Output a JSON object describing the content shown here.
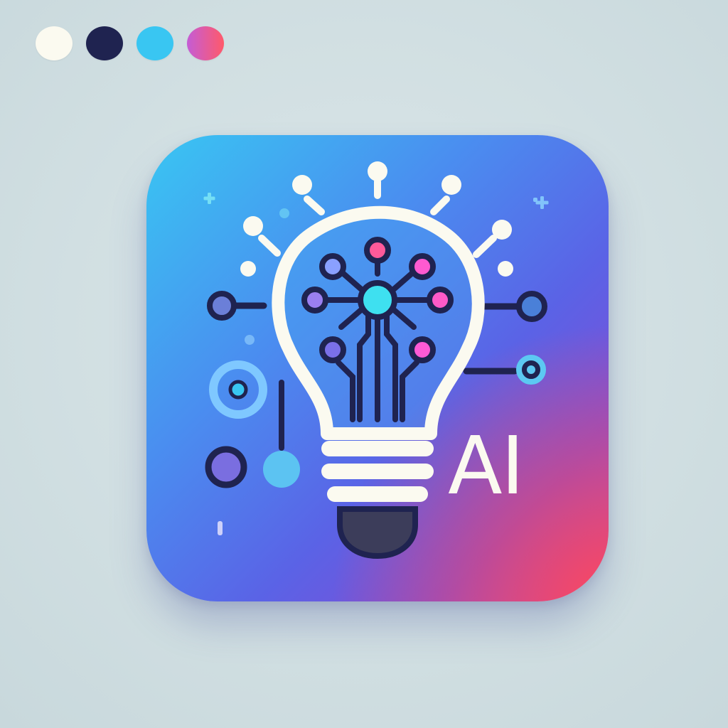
{
  "palette": {
    "colors": [
      "#fbfaf0",
      "#1f2350",
      "#39c6f2",
      "#ff5a6a"
    ],
    "swatch_names": [
      "cream-swatch",
      "navy-swatch",
      "cyan-swatch",
      "pink-gradient-swatch"
    ]
  },
  "app_icon": {
    "label": "AI",
    "icon": "lightbulb-circuit-icon",
    "gradient_colors": [
      "#39c6f2",
      "#5a63e6",
      "#ff5a6a"
    ]
  }
}
